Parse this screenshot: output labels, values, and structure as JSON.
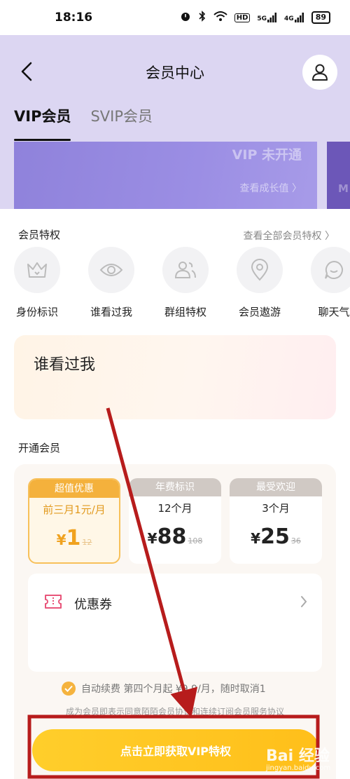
{
  "status_bar": {
    "time": "18:16",
    "network": "5G",
    "network2": "4G",
    "hd": "HD",
    "battery": "89"
  },
  "header": {
    "title": "会员中心"
  },
  "tabs": [
    {
      "label": "VIP会员",
      "active": true
    },
    {
      "label": "SVIP会员",
      "active": false
    }
  ],
  "vip_card": {
    "status": "VIP 未开通",
    "growth_link": "查看成长值 〉",
    "next_card_label": "M"
  },
  "privileges": {
    "heading": "会员特权",
    "see_all": "查看全部会员特权 〉",
    "items": [
      {
        "label": "身份标识",
        "icon": "crown-icon"
      },
      {
        "label": "谁看过我",
        "icon": "eye-icon"
      },
      {
        "label": "群组特权",
        "icon": "group-icon"
      },
      {
        "label": "会员遨游",
        "icon": "location-pin-icon"
      },
      {
        "label": "聊天气",
        "icon": "chat-bubble-icon"
      }
    ]
  },
  "feature_card": {
    "title": "谁看过我"
  },
  "plans": {
    "heading": "开通会员",
    "items": [
      {
        "tag": "超值优惠",
        "name": "前三月1元/月",
        "currency": "¥",
        "price": "1",
        "old_price": "12",
        "selected": true
      },
      {
        "tag": "年费标识",
        "name": "12个月",
        "currency": "¥",
        "price": "88",
        "old_price": "108",
        "selected": false
      },
      {
        "tag": "最受欢迎",
        "name": "3个月",
        "currency": "¥",
        "price": "25",
        "old_price": "36",
        "selected": false
      }
    ]
  },
  "coupon": {
    "label": "优惠券"
  },
  "auto_renew": {
    "text": "自动续费 第四个月起 ¥9.9/月，随时取消1",
    "checked": true
  },
  "agreement": {
    "text": "成为会员即表示同意陌陌会员协议和连续订阅会员服务协议"
  },
  "cta": {
    "label": "点击立即获取VIP特权"
  },
  "watermark": {
    "brand": "Bai  经验",
    "url": "jingyan.baidu.com"
  },
  "colors": {
    "header_bg": "#dcd6f2",
    "accent_gold": "#f4b13c",
    "cta_yellow": "#ffc51f",
    "annotation_red": "#b71c1c"
  }
}
